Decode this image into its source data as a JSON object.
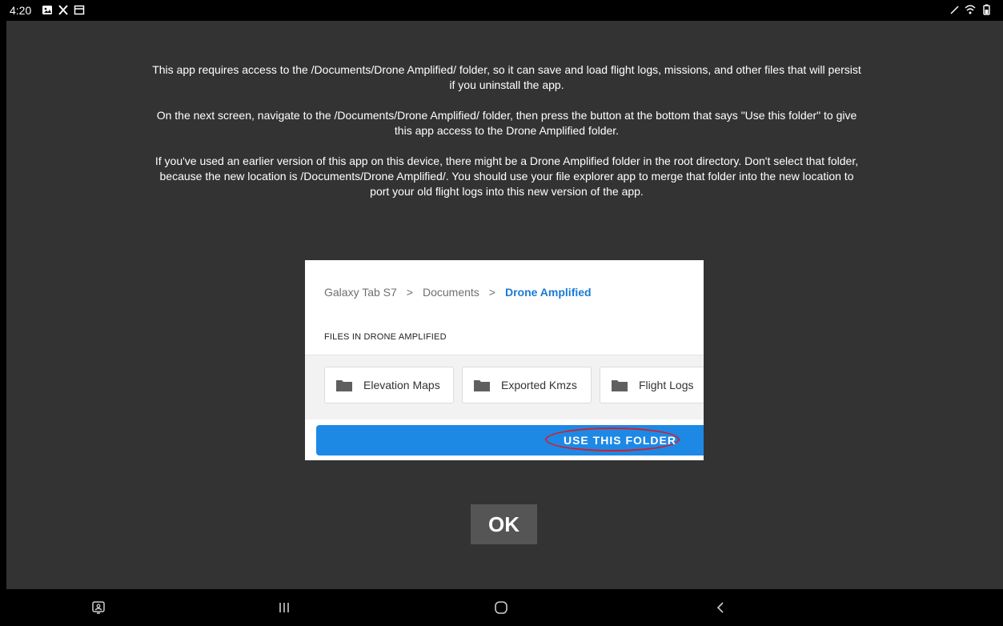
{
  "status_bar": {
    "time": "4:20",
    "left_icons": [
      "notification-image-icon",
      "tools-icon",
      "calendar-icon"
    ],
    "right_icons": [
      "stylus-icon",
      "wifi-icon",
      "battery-icon"
    ]
  },
  "dialog": {
    "paragraphs": [
      "This app requires access to the /Documents/Drone Amplified/ folder, so it can save and load flight logs, missions, and other files that will persist if you uninstall the app.",
      "On the next screen, navigate to the /Documents/Drone Amplified/ folder, then press the button at the bottom that says \"Use this folder\" to give this app access to the Drone Amplified folder.",
      "If you've used an earlier version of this app on this device, there might be a Drone Amplified folder in the root directory. Don't select that folder, because the new location is /Documents/Drone Amplified/. You should use your file explorer app to merge that folder into the new location to port your old flight logs into this new version of the app."
    ],
    "ok_label": "OK"
  },
  "preview": {
    "breadcrumb": [
      "Galaxy Tab S7",
      "Documents",
      "Drone Amplified"
    ],
    "breadcrumb_separator": ">",
    "files_heading": "FILES IN DRONE AMPLIFIED",
    "folders": [
      "Elevation Maps",
      "Exported Kmzs",
      "Flight Logs"
    ],
    "use_folder_label": "USE THIS FOLDER"
  },
  "nav_bar": {
    "buttons": [
      "keyboard-switch-icon",
      "recent-apps-icon",
      "home-icon",
      "back-icon"
    ]
  },
  "colors": {
    "app_background": "#333333",
    "ok_button": "#555555",
    "accent_blue": "#1e88e5",
    "highlight_red": "#d21f2a"
  }
}
